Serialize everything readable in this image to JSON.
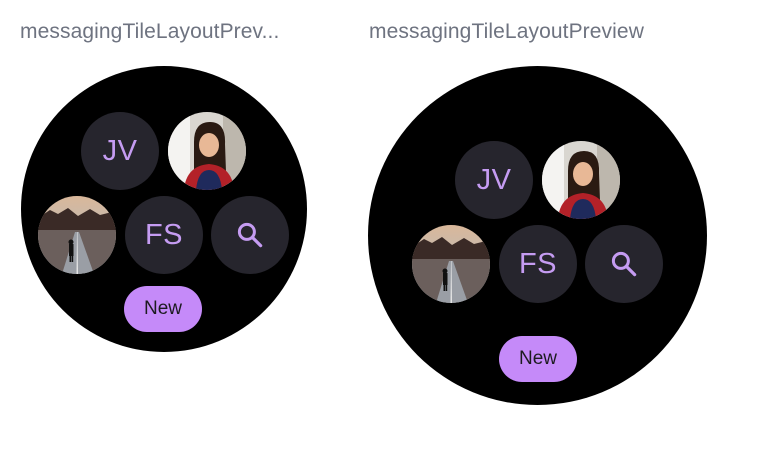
{
  "previews": [
    {
      "title": "messagingTileLayoutPrev...",
      "contacts": [
        {
          "initials": "JV"
        },
        {
          "initials": "FS"
        }
      ],
      "new_button_label": "New"
    },
    {
      "title": "messagingTileLayoutPreview",
      "contacts": [
        {
          "initials": "JV"
        },
        {
          "initials": "FS"
        }
      ],
      "new_button_label": "New"
    }
  ],
  "colors": {
    "watch_background": "#000000",
    "tile_background": "#26252d",
    "accent": "#c59cf2",
    "button_background": "#c58af9",
    "title_text": "#6e7380"
  },
  "icons": {
    "search": "search-icon",
    "avatar_woman": "avatar-photo-icon",
    "avatar_road": "road-photo-icon"
  }
}
